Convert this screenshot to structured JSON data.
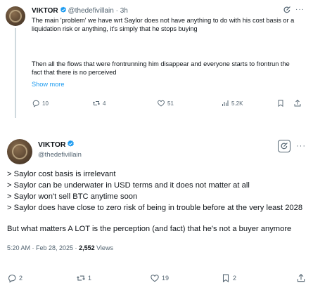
{
  "quoted_tweet": {
    "display_name": "VIKTOR",
    "handle": "@thedefivillain",
    "separator": "·",
    "time": "3h",
    "text_para1": "The main 'problem' we have wrt Saylor does not have anything to do with his cost basis or a liquidation risk or anything, it's simply that he stops buying",
    "text_para2": "Then all the flows that were frontrunning him disappear and everyone starts to frontrun the fact that there is no perceived",
    "show_more": "Show more",
    "actions": {
      "replies": "10",
      "reposts": "4",
      "likes": "51",
      "views": "5.2K"
    }
  },
  "main_tweet": {
    "display_name": "VIKTOR",
    "handle": "@thedefivillain",
    "lines": [
      "> Saylor cost basis is irrelevant",
      "> Saylor can be underwater in USD terms and it does not matter at all",
      "> Saylor won't sell BTC anytime soon",
      "> Saylor does have close to zero risk of being in trouble before at the very least 2028"
    ],
    "closing": "But what matters A LOT is the perception (and fact) that he's not a buyer anymore",
    "timestamp": "5:20 AM · Feb 28, 2025 · ",
    "views_count": "2,552",
    "views_label": " Views",
    "actions": {
      "replies": "2",
      "reposts": "1",
      "likes": "19",
      "bookmarks": "2"
    }
  },
  "colors": {
    "text": "#0f1419",
    "muted": "#536471",
    "link": "#1d9bf0",
    "verified": "#1d9bf0"
  }
}
